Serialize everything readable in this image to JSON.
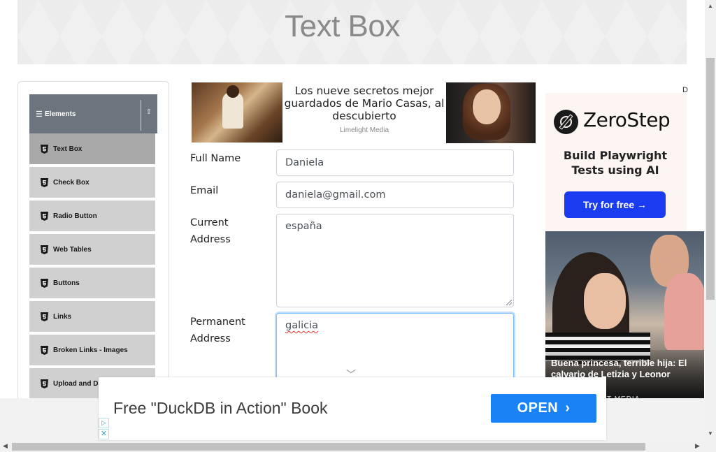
{
  "header": {
    "title": "Text Box"
  },
  "sidebar": {
    "group_title": "Elements",
    "items": [
      {
        "label": "Text Box",
        "active": true
      },
      {
        "label": "Check Box"
      },
      {
        "label": "Radio Button"
      },
      {
        "label": "Web Tables"
      },
      {
        "label": "Buttons"
      },
      {
        "label": "Links"
      },
      {
        "label": "Broken Links - Images"
      },
      {
        "label": "Upload and D"
      }
    ]
  },
  "top_ad": {
    "headline": "Los nueve secretos mejor guardados de Mario Casas, al descubierto",
    "source": "Limelight Media"
  },
  "form": {
    "full_name": {
      "label": "Full Name",
      "value": "Daniela"
    },
    "email": {
      "label": "Email",
      "value": "daniela@gmail.com"
    },
    "current_address": {
      "label_line1": "Current",
      "label_line2": "Address",
      "value": "españa"
    },
    "permanent_address": {
      "label_line1": "Permanent",
      "label_line2": "Address",
      "value": "galicia"
    }
  },
  "right_ad": {
    "brand": "ZeroStep",
    "subtitle_line1": "Build Playwright",
    "subtitle_line2": "Tests using AI",
    "button": "Try for free →",
    "adchoice": "D"
  },
  "news_ad": {
    "headline": "Buena princesa, terrible hija: El calvario de Letizia y Leonor",
    "source": "T MEDIA"
  },
  "bottom_ad": {
    "text": "Free \"DuckDB in Action\" Book",
    "button": "OPEN",
    "button_arrow": "›"
  },
  "colors": {
    "sidebar_header": "#6c757d",
    "menu_item": "#d0d0d0",
    "menu_item_active": "#a9a9a9",
    "zerostep_button": "#1a3cf0",
    "open_button": "#1a82f5",
    "focus_border": "#80bdff"
  }
}
